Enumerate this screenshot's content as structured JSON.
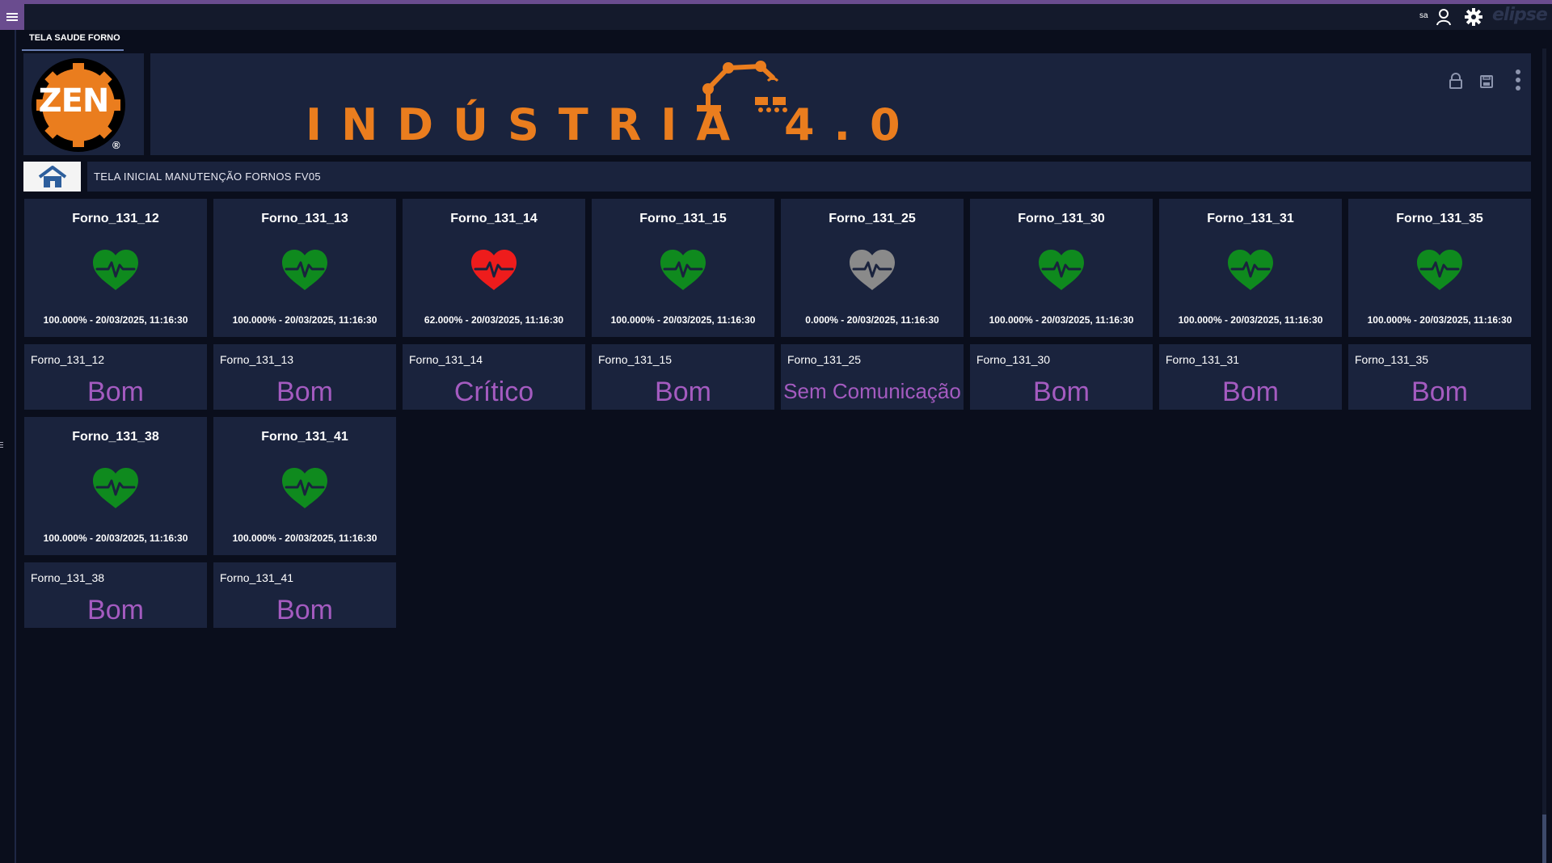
{
  "topbar": {
    "user": "sa",
    "brand": "elipse"
  },
  "tab": {
    "label": "TELA SAUDE FORNO"
  },
  "logo": {
    "text": "ZEN",
    "reg": "®"
  },
  "banner": {
    "title": "INDÚSTRIA 4.0"
  },
  "breadcrumb": {
    "text": "TELA INICIAL MANUTENÇÃO FORNOS FV05"
  },
  "colors": {
    "ok": "#0f8a1e",
    "critical": "#ee1c1c",
    "offline": "#8a8a8a",
    "status_text": "#a45bc0",
    "accent": "#ea7d1e"
  },
  "ovens": [
    {
      "name": "Forno_131_12",
      "info": "100.000% - 20/03/2025, 11:16:30",
      "health": 100.0,
      "state": "ok",
      "status": "Bom"
    },
    {
      "name": "Forno_131_13",
      "info": "100.000% - 20/03/2025, 11:16:30",
      "health": 100.0,
      "state": "ok",
      "status": "Bom"
    },
    {
      "name": "Forno_131_14",
      "info": "62.000% - 20/03/2025, 11:16:30",
      "health": 62.0,
      "state": "critical",
      "status": "Crítico"
    },
    {
      "name": "Forno_131_15",
      "info": "100.000% - 20/03/2025, 11:16:30",
      "health": 100.0,
      "state": "ok",
      "status": "Bom"
    },
    {
      "name": "Forno_131_25",
      "info": "0.000% - 20/03/2025, 11:16:30",
      "health": 0.0,
      "state": "offline",
      "status": "Sem Comunicação"
    },
    {
      "name": "Forno_131_30",
      "info": "100.000% - 20/03/2025, 11:16:30",
      "health": 100.0,
      "state": "ok",
      "status": "Bom"
    },
    {
      "name": "Forno_131_31",
      "info": "100.000% - 20/03/2025, 11:16:30",
      "health": 100.0,
      "state": "ok",
      "status": "Bom"
    },
    {
      "name": "Forno_131_35",
      "info": "100.000% - 20/03/2025, 11:16:30",
      "health": 100.0,
      "state": "ok",
      "status": "Bom"
    },
    {
      "name": "Forno_131_38",
      "info": "100.000% - 20/03/2025, 11:16:30",
      "health": 100.0,
      "state": "ok",
      "status": "Bom"
    },
    {
      "name": "Forno_131_41",
      "info": "100.000% - 20/03/2025, 11:16:30",
      "health": 100.0,
      "state": "ok",
      "status": "Bom"
    }
  ]
}
